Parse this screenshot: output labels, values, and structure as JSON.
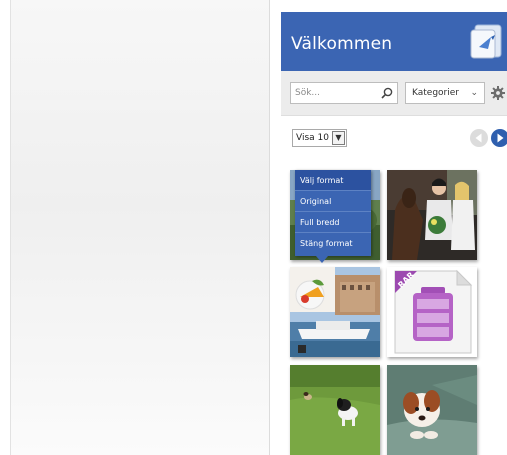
{
  "panel": {
    "title": "Välkommen",
    "logo_icon": "app-logo-icon",
    "accent_color": "#3b65b3"
  },
  "toolbar": {
    "search_placeholder": "Sök...",
    "search_icon": "search-icon",
    "category_label": "Kategorier",
    "category_icon": "chevron-down-icon",
    "settings_icon": "gear-icon"
  },
  "listing": {
    "show_label": "Visa 10",
    "prev_icon": "chevron-left-icon",
    "next_icon": "chevron-right-icon"
  },
  "format_menu": {
    "items": [
      "Välj format",
      "Original",
      "Full bredd",
      "Stäng format"
    ]
  },
  "gallery": {
    "items": [
      {
        "subject": "photo-with-format-menu"
      },
      {
        "subject": "horse-race-winners-photo"
      },
      {
        "subject": "food-and-harbor-collage"
      },
      {
        "subject": "rar-archive-file",
        "badge": "RAR"
      },
      {
        "subject": "dog-on-grass-photo"
      },
      {
        "subject": "puppy-on-blanket-photo"
      }
    ]
  }
}
